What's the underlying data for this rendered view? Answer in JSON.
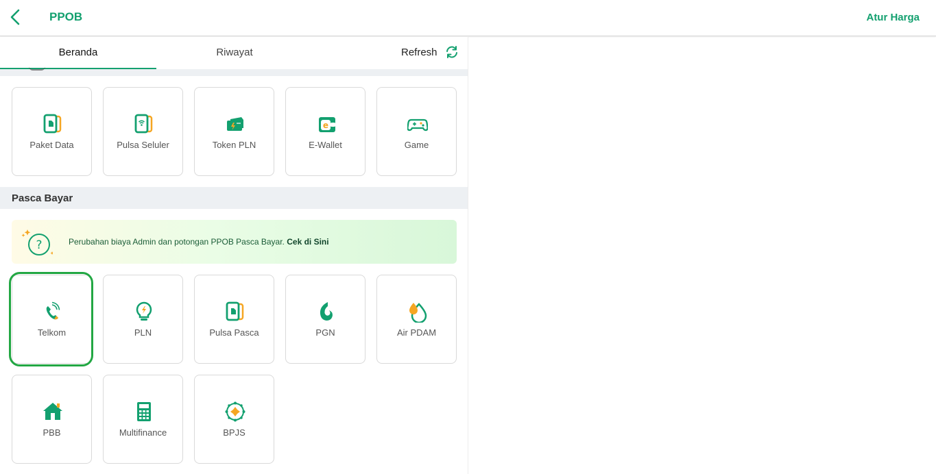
{
  "header": {
    "title": "PPOB",
    "back_icon": "chevron-left-icon",
    "right_action": "Atur Harga"
  },
  "tabs": [
    {
      "label": "Beranda",
      "active": true
    },
    {
      "label": "Riwayat",
      "active": false
    }
  ],
  "refresh": {
    "label": "Refresh",
    "icon": "refresh-icon"
  },
  "prabayar": {
    "items": [
      {
        "label": "Paket Data",
        "icon": "sim-card-icon"
      },
      {
        "label": "Pulsa Seluler",
        "icon": "phone-signal-icon"
      },
      {
        "label": "Token PLN",
        "icon": "electric-token-icon"
      },
      {
        "label": "E-Wallet",
        "icon": "wallet-icon"
      },
      {
        "label": "Game",
        "icon": "gamepad-icon"
      }
    ]
  },
  "pascabayar": {
    "title": "Pasca Bayar",
    "banner": {
      "text": "Perubahan biaya Admin dan potongan PPOB Pasca Bayar.",
      "link": "Cek di Sini",
      "icon": "question-sparkle-icon"
    },
    "items": [
      {
        "label": "Telkom",
        "icon": "telephone-icon",
        "selected": true
      },
      {
        "label": "PLN",
        "icon": "lightbulb-icon"
      },
      {
        "label": "Pulsa Pasca",
        "icon": "sim-card-icon"
      },
      {
        "label": "PGN",
        "icon": "gas-flame-icon"
      },
      {
        "label": "Air PDAM",
        "icon": "water-drop-icon"
      },
      {
        "label": "PBB",
        "icon": "house-icon"
      },
      {
        "label": "Multifinance",
        "icon": "calculator-icon"
      },
      {
        "label": "BPJS",
        "icon": "bpjs-logo-icon"
      }
    ]
  },
  "colors": {
    "primary": "#13a06f",
    "accent": "#f5a623",
    "selected_border": "#22a743",
    "section_bg": "#edf0f3"
  }
}
